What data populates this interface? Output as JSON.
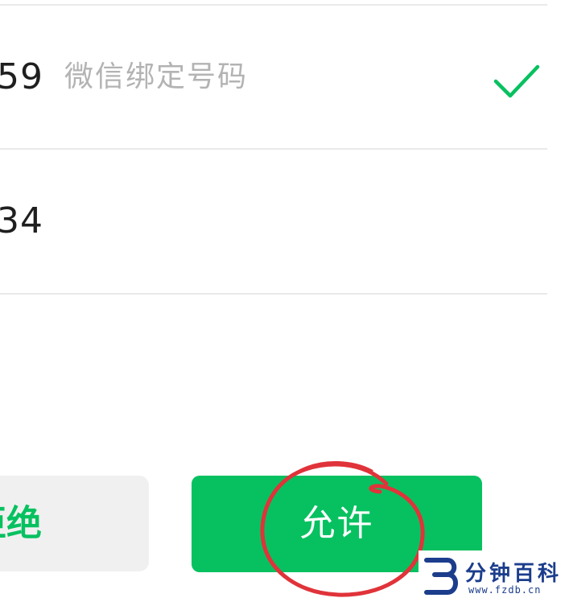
{
  "phone_list": {
    "rows": [
      {
        "number_suffix": "59",
        "note": "微信绑定号码",
        "selected": true
      },
      {
        "number_suffix": "34",
        "note": "",
        "selected": false
      }
    ]
  },
  "actions": {
    "reject_label": "拒绝",
    "allow_label": "允许"
  },
  "watermark": {
    "name": "分钟百科",
    "url": "www.fzdb.cn"
  },
  "colors": {
    "accent_green": "#07c160",
    "annotation_red": "#e0333a",
    "watermark_blue": "#1b3d8c"
  },
  "icons": {
    "selected": "check-icon",
    "annotation": "red-circle-annotation"
  }
}
